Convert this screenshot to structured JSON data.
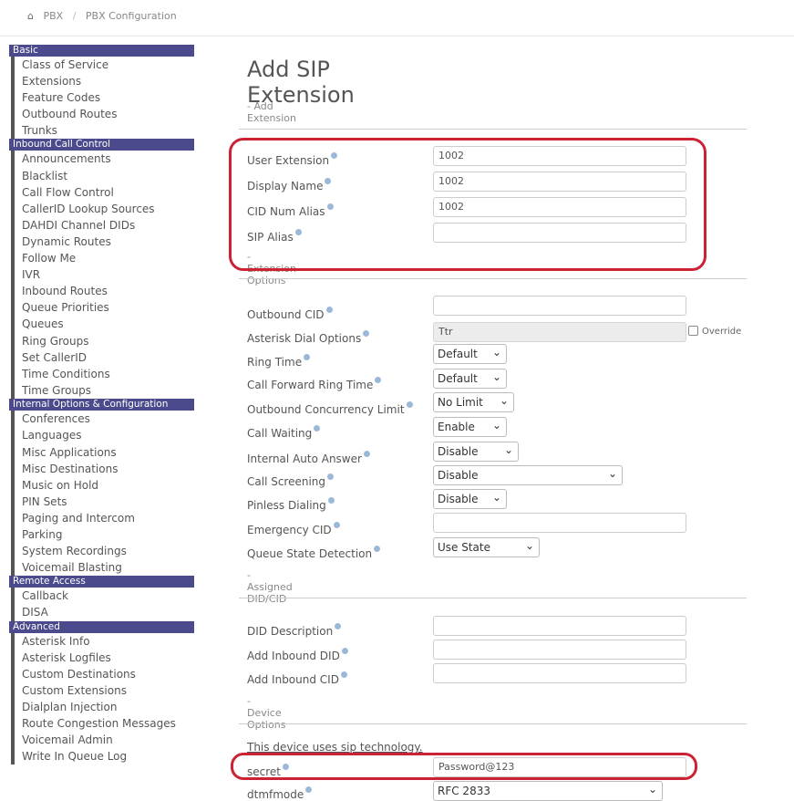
{
  "breadcrumb": {
    "home_icon": "⌂",
    "items": [
      "PBX",
      "PBX Configuration"
    ],
    "separator": "/"
  },
  "sidebar": {
    "sections": [
      {
        "title": "Basic",
        "items": [
          "Class of Service",
          "Extensions",
          "Feature Codes",
          "Outbound Routes",
          "Trunks"
        ]
      },
      {
        "title": "Inbound Call Control",
        "items": [
          "Announcements",
          "Blacklist",
          "Call Flow Control",
          "CallerID Lookup Sources",
          "DAHDI Channel DIDs",
          "Dynamic Routes",
          "Follow Me",
          "IVR",
          "Inbound Routes",
          "Queue Priorities",
          "Queues",
          "Ring Groups",
          "Set CallerID",
          "Time Conditions",
          "Time Groups"
        ]
      },
      {
        "title": "Internal Options & Configuration",
        "items": [
          "Conferences",
          "Languages",
          "Misc Applications",
          "Misc Destinations",
          "Music on Hold",
          "PIN Sets",
          "Paging and Intercom",
          "Parking",
          "System Recordings",
          "Voicemail Blasting"
        ]
      },
      {
        "title": "Remote Access",
        "items": [
          "Callback",
          "DISA"
        ]
      },
      {
        "title": "Advanced",
        "items": [
          "Asterisk Info",
          "Asterisk Logfiles",
          "Custom Destinations",
          "Custom Extensions",
          "Dialplan Injection",
          "Route Congestion Messages",
          "Voicemail Admin",
          "Write In Queue Log"
        ]
      }
    ]
  },
  "main": {
    "title": "Add SIP Extension",
    "add_extension_header": "- Add Extension",
    "extension_options_header": "- Extension Options",
    "assigned_did_header": "- Assigned DID/CID",
    "device_options_header": "- Device Options",
    "device_note": "This device uses sip technology.",
    "fields": {
      "user_extension": {
        "label": "User Extension",
        "value": "1002"
      },
      "display_name": {
        "label": "Display Name",
        "value": "1002"
      },
      "cid_num_alias": {
        "label": "CID Num Alias",
        "value": "1002"
      },
      "sip_alias": {
        "label": "SIP Alias",
        "value": ""
      },
      "outbound_cid": {
        "label": "Outbound CID",
        "value": ""
      },
      "asterisk_dial_options": {
        "label": "Asterisk Dial Options",
        "value": "Ttr",
        "override_label": "Override"
      },
      "ring_time": {
        "label": "Ring Time",
        "value": "Default"
      },
      "call_forward_ring_time": {
        "label": "Call Forward Ring Time",
        "value": "Default"
      },
      "outbound_concurrency_limit": {
        "label": "Outbound Concurrency Limit",
        "value": "No Limit"
      },
      "call_waiting": {
        "label": "Call Waiting",
        "value": "Enable"
      },
      "internal_auto_answer": {
        "label": "Internal Auto Answer",
        "value": "Disable"
      },
      "call_screening": {
        "label": "Call Screening",
        "value": "Disable"
      },
      "pinless_dialing": {
        "label": "Pinless Dialing",
        "value": "Disable"
      },
      "emergency_cid": {
        "label": "Emergency CID",
        "value": ""
      },
      "queue_state_detection": {
        "label": "Queue State Detection",
        "value": "Use State"
      },
      "did_description": {
        "label": "DID Description",
        "value": ""
      },
      "add_inbound_did": {
        "label": "Add Inbound DID",
        "value": ""
      },
      "add_inbound_cid": {
        "label": "Add Inbound CID",
        "value": ""
      },
      "secret": {
        "label": "secret",
        "value": "Password@123"
      },
      "dtmfmode": {
        "label": "dtmfmode",
        "value": "RFC 2833"
      }
    }
  },
  "colors": {
    "sidebar_section_bg": "#4a4a8c",
    "highlight_red": "#cc2233",
    "help_icon": "#9cb8d8"
  }
}
